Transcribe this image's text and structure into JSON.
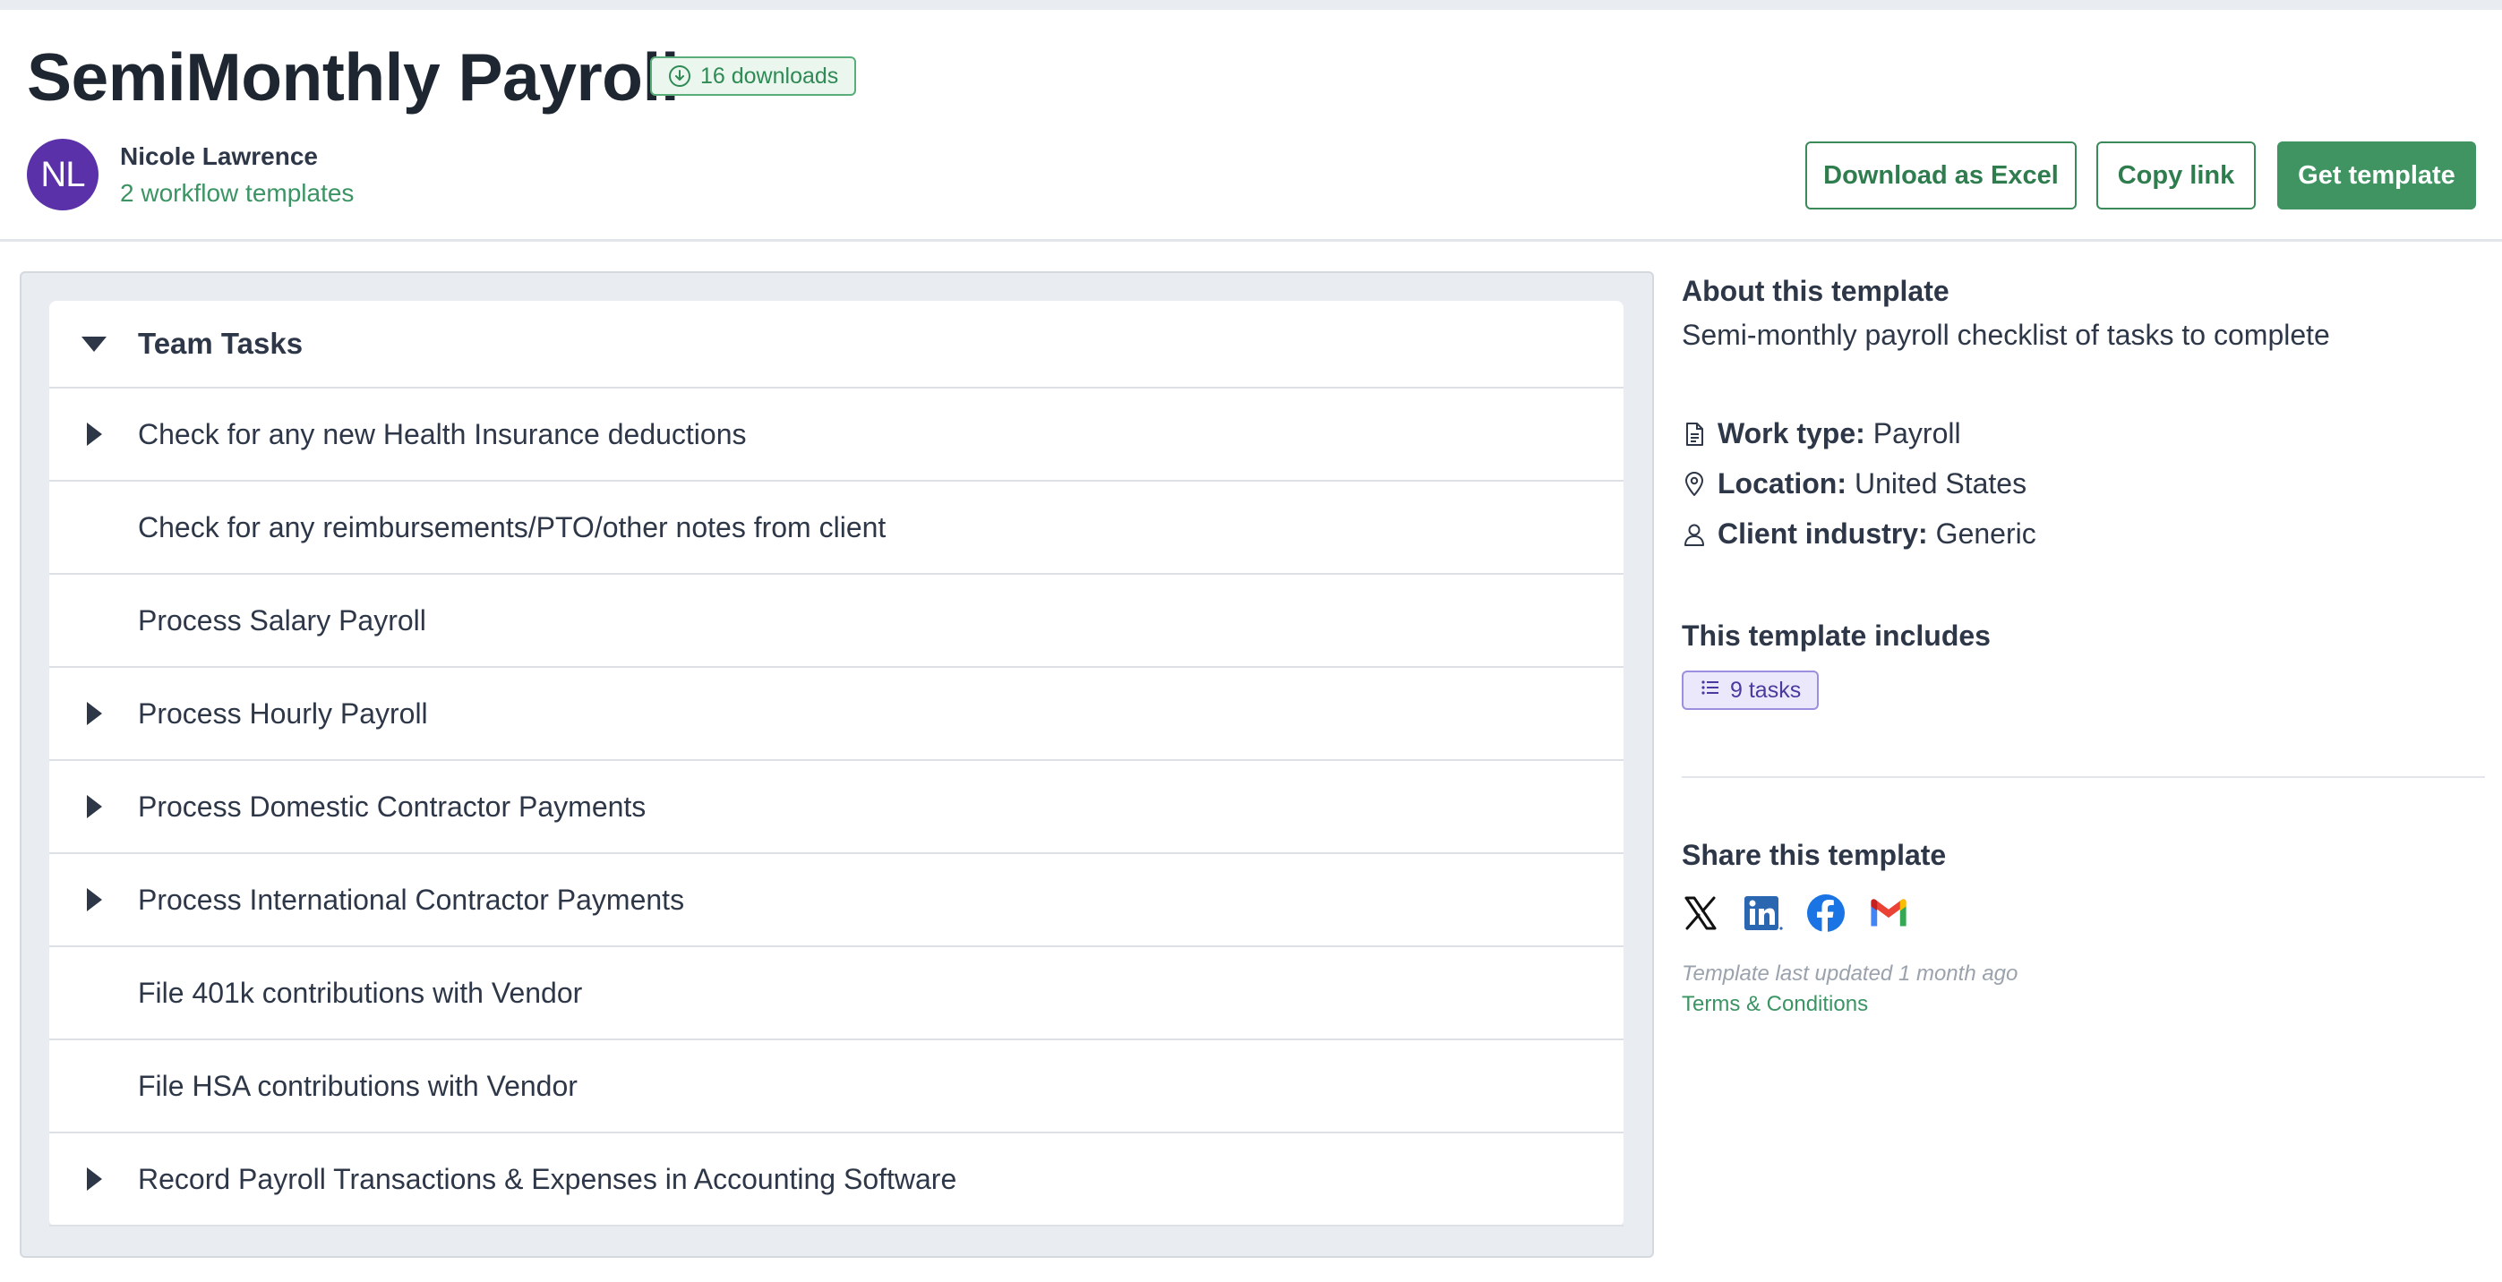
{
  "header": {
    "title": "SemiMonthly Payroll",
    "downloads_badge": "16 downloads",
    "author": {
      "initials": "NL",
      "name": "Nicole Lawrence",
      "templates_link": "2 workflow templates"
    },
    "buttons": {
      "download_excel": "Download as Excel",
      "copy_link": "Copy link",
      "get_template": "Get template"
    }
  },
  "tasks": {
    "section_title": "Team Tasks",
    "items": [
      {
        "label": "Check for any new Health Insurance deductions",
        "expandable": true
      },
      {
        "label": "Check for any reimbursements/PTO/other notes from client",
        "expandable": false
      },
      {
        "label": "Process Salary Payroll",
        "expandable": false
      },
      {
        "label": "Process Hourly Payroll",
        "expandable": true
      },
      {
        "label": "Process Domestic Contractor Payments",
        "expandable": true
      },
      {
        "label": "Process International Contractor Payments",
        "expandable": true
      },
      {
        "label": "File 401k contributions with Vendor",
        "expandable": false
      },
      {
        "label": "File HSA contributions with Vendor",
        "expandable": false
      },
      {
        "label": "Record Payroll Transactions & Expenses in Accounting Software",
        "expandable": true
      }
    ]
  },
  "about": {
    "heading": "About this template",
    "description": "Semi-monthly payroll checklist of tasks to complete",
    "work_type_label": "Work type:",
    "work_type_value": "Payroll",
    "location_label": "Location:",
    "location_value": "United States",
    "industry_label": "Client industry:",
    "industry_value": "Generic"
  },
  "includes": {
    "heading": "This template includes",
    "tasks_badge": "9 tasks"
  },
  "share": {
    "heading": "Share this template",
    "icons": [
      "x-icon",
      "linkedin-icon",
      "facebook-icon",
      "gmail-icon"
    ]
  },
  "footer": {
    "updated": "Template last updated 1 month ago",
    "terms": "Terms & Conditions"
  },
  "colors": {
    "brand_green": "#3f9462",
    "avatar_purple": "#5a31a8",
    "badge_purple": "#ece8fb"
  }
}
